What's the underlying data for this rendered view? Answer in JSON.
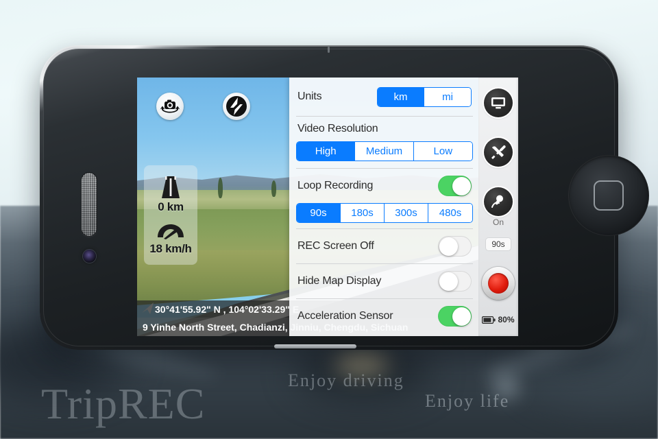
{
  "background": {
    "watermark_brand": "TripREC",
    "watermark_tagline_left": "Enjoy  driving",
    "watermark_tagline_right": "Enjoy  life"
  },
  "camera_overlay": {
    "switch_camera_icon": "switch-camera-icon",
    "flash_off_icon": "flash-off-icon",
    "hud": {
      "distance_icon": "road-icon",
      "distance_value": "0 km",
      "speed_icon": "speedometer-icon",
      "speed_value": "18 km/h"
    },
    "gps_coordinates": "30°41'55.92\" N , 104°02'33.29\" E",
    "gps_address": "9 Yinhe North Street, Chadianzi, Jinniu, Chengdu, Sichuan"
  },
  "settings": {
    "units": {
      "label": "Units",
      "options": [
        "km",
        "mi"
      ],
      "selected": "km"
    },
    "video_resolution": {
      "label": "Video Resolution",
      "options": [
        "High",
        "Medium",
        "Low"
      ],
      "selected": "High"
    },
    "loop_recording": {
      "label": "Loop Recording",
      "enabled": true,
      "options": [
        "90s",
        "180s",
        "300s",
        "480s"
      ],
      "selected": "90s"
    },
    "rec_screen_off": {
      "label": "REC Screen Off",
      "enabled": false
    },
    "hide_map_display": {
      "label": "Hide Map Display",
      "enabled": false
    },
    "acceleration_sensor": {
      "label": "Acceleration Sensor",
      "enabled": true
    }
  },
  "rail": {
    "display_icon": "monitor-icon",
    "settings_icon": "tools-icon",
    "microphone_icon": "microphone-icon",
    "microphone_state": "On",
    "loop_duration": "90s",
    "record_button": "record-button",
    "battery_icon": "battery-icon",
    "battery_level": "80%"
  },
  "colors": {
    "accent_blue": "#0a7cff",
    "toggle_green": "#4bd363",
    "record_red": "#e01b0c"
  }
}
